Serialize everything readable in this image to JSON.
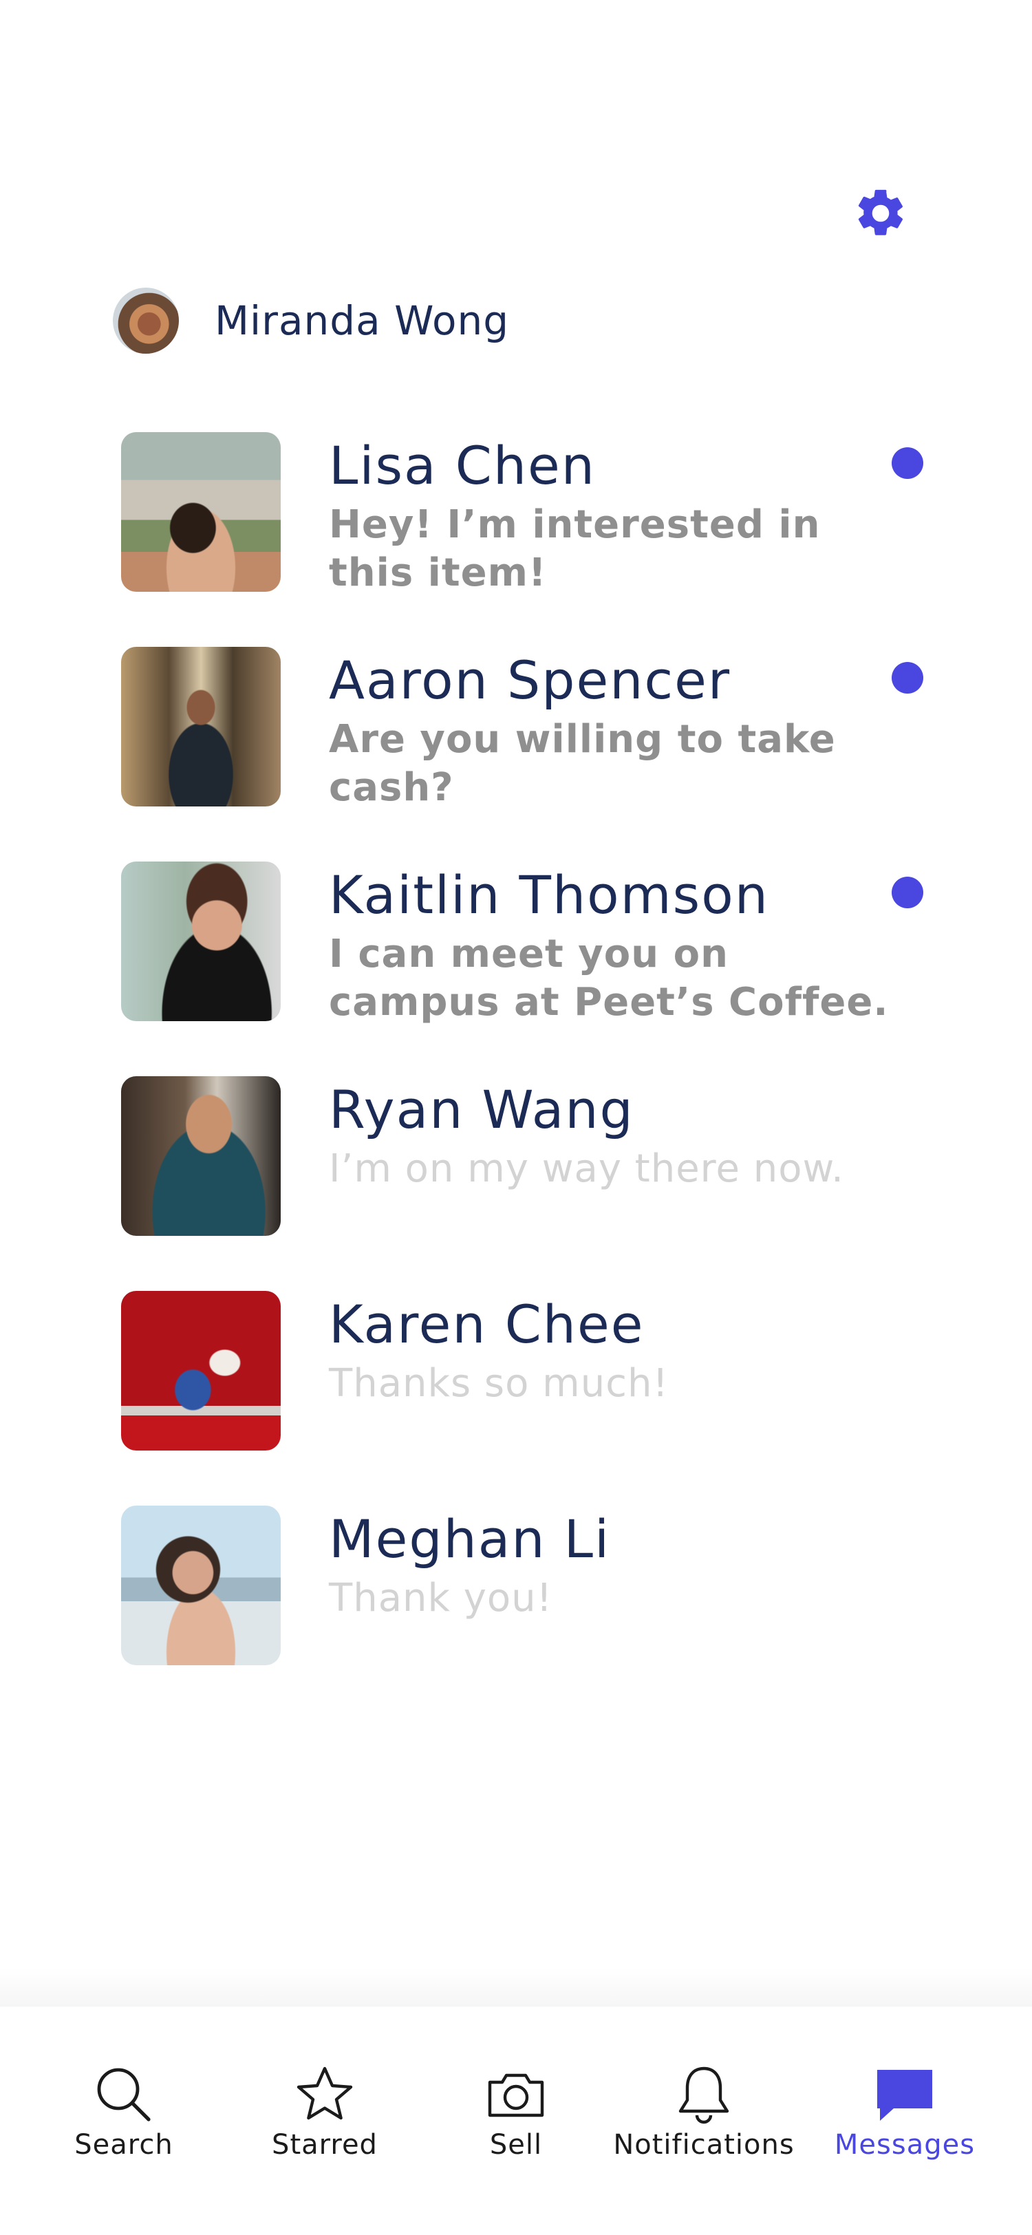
{
  "header": {
    "settings_icon": "gear-icon",
    "user_name": "Miranda Wong"
  },
  "conversations": [
    {
      "name": "Lisa Chen",
      "message": "Hey! I’m interested in this item!",
      "unread": true
    },
    {
      "name": "Aaron Spencer",
      "message": "Are you willing to take cash?",
      "unread": true
    },
    {
      "name": "Kaitlin Thomson",
      "message": "I can meet you on campus at Peet’s Coffee.",
      "unread": true
    },
    {
      "name": "Ryan Wang",
      "message": "I’m on my way there now.",
      "unread": false
    },
    {
      "name": "Karen Chee",
      "message": "Thanks so much!",
      "unread": false
    },
    {
      "name": "Meghan Li",
      "message": "Thank you!",
      "unread": false
    }
  ],
  "tabbar": {
    "tabs": [
      {
        "label": "Search",
        "icon": "search-icon"
      },
      {
        "label": "Starred",
        "icon": "star-icon"
      },
      {
        "label": "Sell",
        "icon": "camera-icon"
      },
      {
        "label": "Notifications",
        "icon": "bell-icon"
      },
      {
        "label": "Messages",
        "icon": "chat-bubble-icon",
        "active": true
      }
    ]
  },
  "colors": {
    "accent": "#4a46e0",
    "name_text": "#1b2b55",
    "unread_text": "#8f8f8f",
    "read_text": "#d3d3d3"
  }
}
